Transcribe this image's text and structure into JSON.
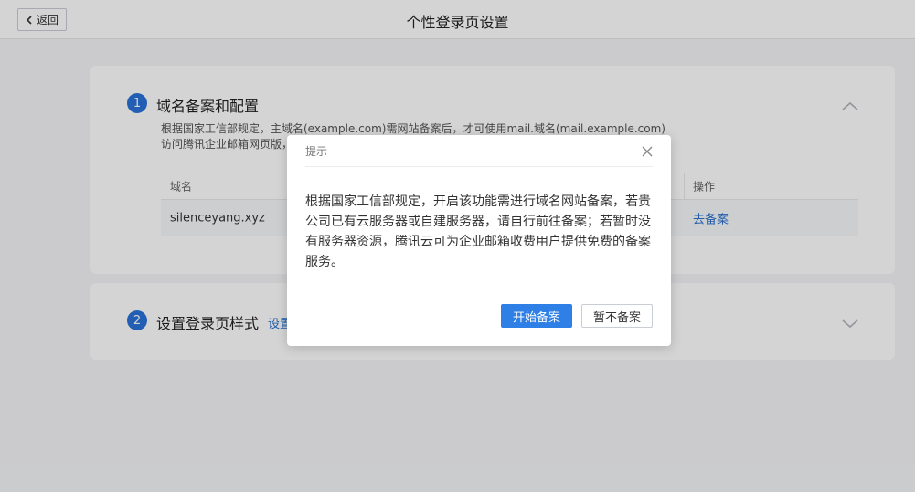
{
  "header": {
    "back_label": "返回",
    "title": "个性登录页设置"
  },
  "section1": {
    "step": "1",
    "title": "域名备案和配置",
    "desc_line1": "根据国家工信部规定，主域名(example.com)需网站备案后，才可使用mail.域名(mail.example.com)",
    "desc_line2": "访问腾讯企业邮箱网页版，",
    "columns": [
      "域名",
      "操作"
    ],
    "rows": [
      {
        "domain": "silenceyang.xyz",
        "action": "去备案"
      }
    ]
  },
  "section2": {
    "step": "2",
    "title": "设置登录页样式",
    "link": "设置"
  },
  "dialog": {
    "title": "提示",
    "body": "根据国家工信部规定，开启该功能需进行域名网站备案，若贵公司已有云服务器或自建服务器，请自行前往备案；若暂时没有服务器资源，腾讯云可为企业邮箱收费用户提供免费的备案服务。",
    "primary_label": "开始备案",
    "secondary_label": "暂不备案"
  },
  "colors": {
    "accent": "#2a73d9",
    "primary_button": "#2e80e6",
    "link": "#2a6fce"
  },
  "icons": {
    "back": "chevron-left-icon",
    "collapse": "chevron-up-icon",
    "expand": "chevron-down-icon",
    "close": "close-icon"
  }
}
